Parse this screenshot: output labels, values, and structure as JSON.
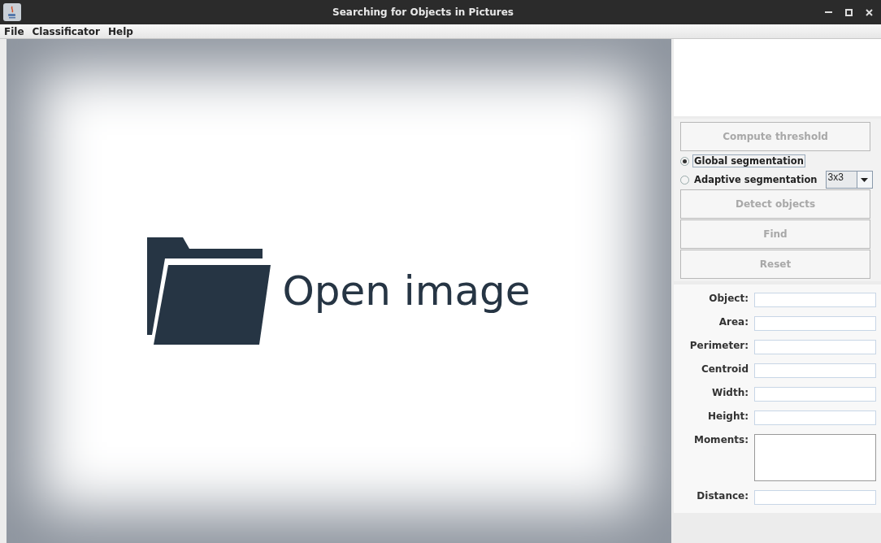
{
  "window": {
    "title": "Searching for Objects in Pictures"
  },
  "menu": [
    {
      "label": "File"
    },
    {
      "label": "Classificator"
    },
    {
      "label": "Help"
    }
  ],
  "image_view": {
    "prompt": "Open image"
  },
  "controls": {
    "compute_button": {
      "label": "Compute threshold",
      "disabled": true
    },
    "segmentation": [
      {
        "label": "Global segmentation",
        "selected": true,
        "focused": true
      },
      {
        "label": "Adaptive segmentation",
        "selected": false,
        "focused": false
      }
    ],
    "window_size": {
      "value": "3x3"
    },
    "buttons": [
      {
        "label": "Detect objects",
        "disabled": true
      },
      {
        "label": "Find",
        "disabled": true
      },
      {
        "label": "Reset",
        "disabled": true
      }
    ]
  },
  "properties": [
    {
      "label": "Object:",
      "kind": "field"
    },
    {
      "label": "Area:",
      "kind": "field"
    },
    {
      "label": "Perimeter:",
      "kind": "field"
    },
    {
      "label": "Centroid",
      "kind": "field"
    },
    {
      "label": "Width:",
      "kind": "field"
    },
    {
      "label": "Height:",
      "kind": "field"
    },
    {
      "label": "Moments:",
      "kind": "area"
    },
    {
      "label": "Distance:",
      "kind": "field"
    }
  ]
}
